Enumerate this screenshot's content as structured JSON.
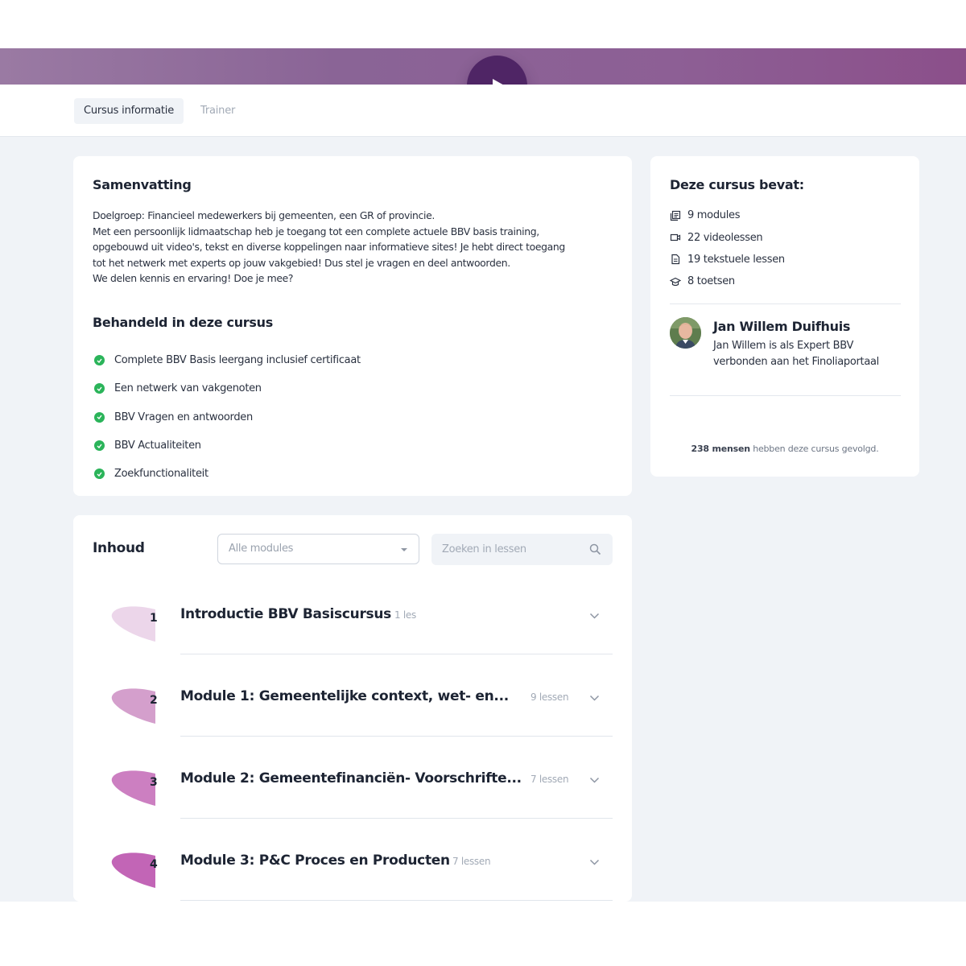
{
  "hero": {
    "play_icon": "play-icon",
    "accent": "#4f2565"
  },
  "tabs": [
    {
      "label": "Cursus informatie",
      "active": true
    },
    {
      "label": "Trainer",
      "active": false
    }
  ],
  "summary": {
    "title": "Samenvatting",
    "lines": [
      "Doelgroep: Financieel medewerkers bij gemeenten, een GR of provincie.",
      "Met een persoonlijk lidmaatschap heb je toegang tot een complete actuele BBV basis training,",
      "opgebouwd uit video's, tekst en diverse koppelingen naar informatieve sites! Je hebt direct toegang",
      "tot het netwerk met experts op jouw vakgebied! Dus stel je vragen en deel antwoorden.",
      "We delen kennis en ervaring! Doe je mee?"
    ],
    "topics_title": "Behandeld in deze cursus",
    "topics": [
      "Complete BBV Basis leergang inclusief certificaat",
      "Een netwerk van vakgenoten",
      "BBV Vragen en antwoorden",
      "BBV Actualiteiten",
      "Zoekfunctionaliteit"
    ],
    "check_color": "#2bb45a"
  },
  "course_contents": {
    "title": "Deze cursus bevat:",
    "items": [
      {
        "icon": "modules-icon",
        "label": "9 modules"
      },
      {
        "icon": "video-icon",
        "label": "22 videolessen"
      },
      {
        "icon": "document-icon",
        "label": "19 tekstuele lessen"
      },
      {
        "icon": "graduation-cap-icon",
        "label": "8 toetsen"
      }
    ]
  },
  "trainer": {
    "name": "Jan Willem Duifhuis",
    "description": "Jan Willem is als Expert BBV verbonden aan het Finoliaportaal"
  },
  "followers": {
    "count": "238 mensen",
    "text": "hebben deze cursus gevolgd."
  },
  "inhoud": {
    "title": "Inhoud",
    "select_value": "Alle modules",
    "search_placeholder": "Zoeken in lessen",
    "modules": [
      {
        "number": "1",
        "title": "Introductie BBV Basiscursus",
        "count": "1 les",
        "color": "#ecd6ea"
      },
      {
        "number": "2",
        "title": "Module 1: Gemeentelijke context, wet- en...",
        "count": "9 lessen",
        "color": "#d49fcc"
      },
      {
        "number": "3",
        "title": "Module 2: Gemeentefinanciën- Voorschrifte...",
        "count": "7 lessen",
        "color": "#cc7fc1"
      },
      {
        "number": "4",
        "title": "Module 3: P&C Proces en Producten",
        "count": "7 lessen",
        "color": "#c265b6"
      }
    ]
  }
}
